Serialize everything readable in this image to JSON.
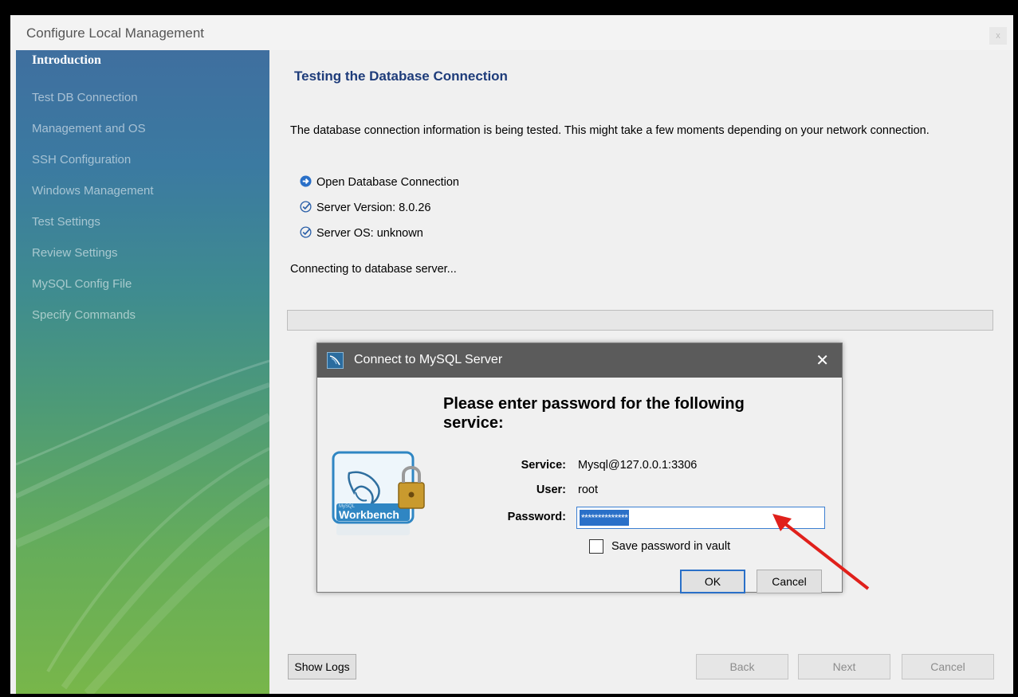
{
  "window": {
    "title": "Configure Local Management",
    "close_label": "x"
  },
  "sidebar": {
    "items": [
      {
        "label": "Introduction"
      },
      {
        "label": "Test DB Connection"
      },
      {
        "label": "Management and OS"
      },
      {
        "label": "SSH Configuration"
      },
      {
        "label": "Windows Management"
      },
      {
        "label": "Test Settings"
      },
      {
        "label": "Review Settings"
      },
      {
        "label": "MySQL Config File"
      },
      {
        "label": "Specify Commands"
      }
    ],
    "active_item": "Introduction"
  },
  "main": {
    "title": "Testing the Database Connection",
    "description": "The database connection information is being tested. This might take a few moments depending on your network connection.",
    "steps": [
      {
        "label": "Open Database Connection",
        "state": "in-progress",
        "icon": "arrow-right-circle-icon"
      },
      {
        "label": "Server Version: 8.0.26",
        "state": "done",
        "icon": "check-circle-icon"
      },
      {
        "label": "Server OS: unknown",
        "state": "done",
        "icon": "check-circle-icon"
      }
    ],
    "status": "Connecting to database server...",
    "progress_fraction": 0
  },
  "footer": {
    "show_logs": "Show Logs",
    "back": "Back",
    "next": "Next",
    "cancel": "Cancel"
  },
  "dialog": {
    "title": "Connect to MySQL Server",
    "close_glyph": "✕",
    "heading": "Please enter password for the following service:",
    "service_label": "Service:",
    "service_value": "Mysql@127.0.0.1:3306",
    "user_label": "User:",
    "user_value": "root",
    "password_label": "Password:",
    "password_masked": "**************",
    "save_password_label": "Save password in vault",
    "save_password_checked": false,
    "ok_label": "OK",
    "cancel_label": "Cancel",
    "logo_text": {
      "brand": "MySQL",
      "product": "Workbench"
    }
  },
  "colors": {
    "accent": "#2a70c8",
    "heading": "#1e3c7a",
    "annotation_arrow": "#e0201b"
  }
}
